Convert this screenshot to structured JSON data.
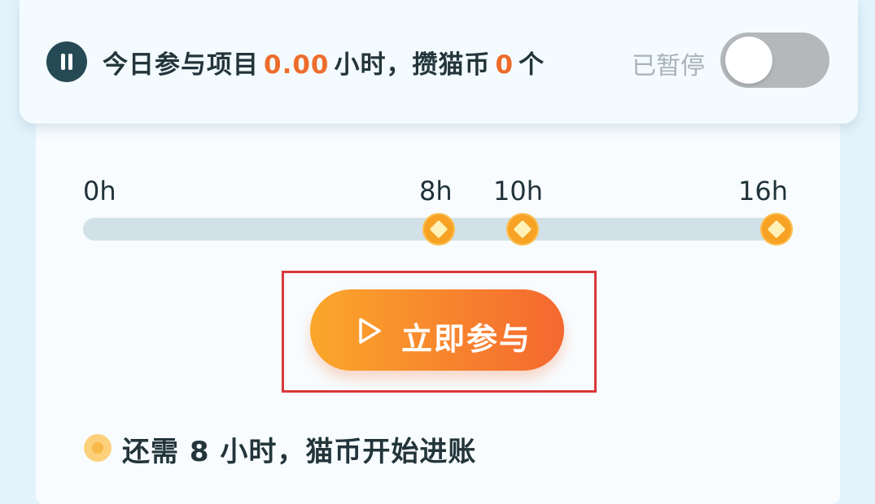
{
  "status": {
    "prefix": "今日参与项目",
    "hours": "0.00",
    "middle": "小时，攒猫币",
    "coins": "0",
    "suffix": "个",
    "paused_label": "已暂停",
    "toggle_on": false
  },
  "timeline": {
    "ticks": [
      "0h",
      "8h",
      "10h",
      "16h"
    ],
    "progress": 0.0
  },
  "join_button": {
    "label": "立即参与"
  },
  "hint": {
    "text": "还需 8 小时，猫币开始进账"
  },
  "colors": {
    "accent": "#ee6c2b",
    "button_start": "#fba72b",
    "button_end": "#f4682f",
    "dark": "#264a53",
    "highlight": "#d9383b"
  },
  "icons": {
    "pause": "pause-icon",
    "play": "play-icon",
    "milestone": "diamond-coin-icon",
    "coin": "coin-icon"
  }
}
